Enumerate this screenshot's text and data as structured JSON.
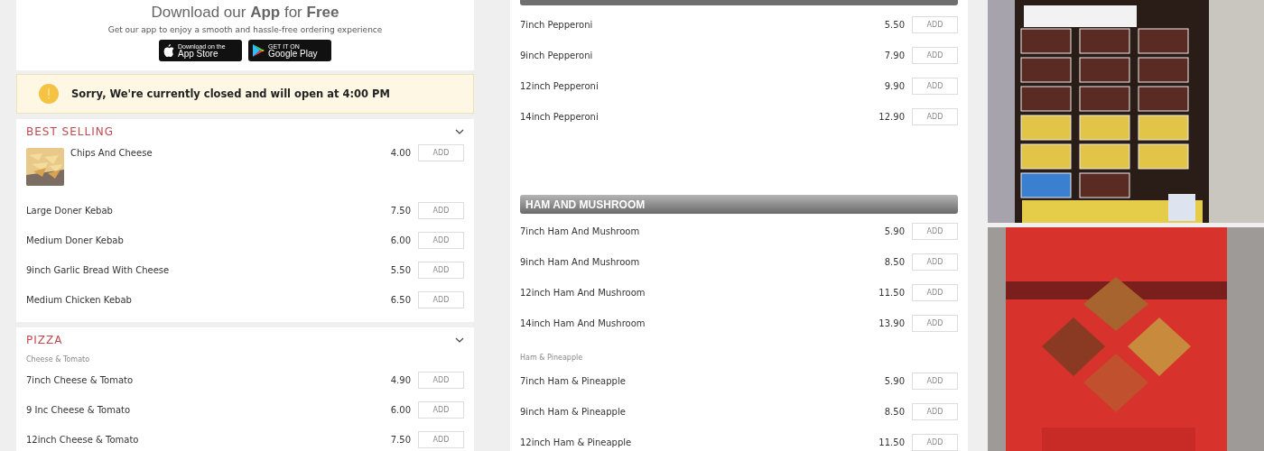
{
  "app_promo": {
    "title": "Download our **App** for **Free**",
    "subtitle": "Get our app to enjoy a smooth and hassle-free ordering experience",
    "store_badges": [
      {
        "kind": "apple",
        "small": "Download on the",
        "big": "App Store"
      },
      {
        "kind": "google",
        "small": "GET IT ON",
        "big": "Google Play"
      }
    ]
  },
  "notice": {
    "text": "Sorry, We're currently closed and will open at 4:00 PM"
  },
  "sections": [
    {
      "title": "BEST SELLING",
      "expanded": true,
      "groups": [
        {
          "items": [
            {
              "name": "Chips And Cheese",
              "price": "4.00",
              "image": true,
              "button": "ADD"
            },
            {
              "name": "Large Doner Kebab",
              "price": "7.50",
              "image": false,
              "button": "ADD"
            },
            {
              "name": "Medium Doner Kebab",
              "price": "6.00",
              "image": false,
              "button": "ADD"
            },
            {
              "name": "9inch Garlic Bread With Cheese",
              "price": "5.50",
              "image": false,
              "button": "ADD"
            },
            {
              "name": "Medium Chicken Kebab",
              "price": "6.50",
              "image": false,
              "button": "ADD"
            }
          ]
        }
      ]
    },
    {
      "title": "PIZZA",
      "expanded": true,
      "groups": [
        {
          "subtitle": "Cheese & Tomato",
          "items": [
            {
              "name": "7inch Cheese & Tomato",
              "price": "4.90",
              "image": false,
              "button": "ADD"
            },
            {
              "name": "9 Inc Cheese & Tomato",
              "price": "6.00",
              "image": false,
              "button": "ADD"
            },
            {
              "name": "12inch Cheese & Tomato",
              "price": "7.50",
              "image": false,
              "button": "ADD"
            }
          ]
        }
      ]
    }
  ],
  "menu_panel": {
    "categories": [
      {
        "groups": [
          {
            "items": [
              {
                "name": "7inch Pepperoni",
                "price": "5.50",
                "button": "ADD"
              },
              {
                "name": "9inch Pepperoni",
                "price": "7.90",
                "button": "ADD"
              },
              {
                "name": "12inch Pepperoni",
                "price": "9.90",
                "button": "ADD"
              },
              {
                "name": "14inch Pepperoni",
                "price": "12.90",
                "button": "ADD"
              }
            ]
          }
        ]
      },
      {
        "title": "HAM AND MUSHROOM",
        "groups": [
          {
            "items": [
              {
                "name": "7inch Ham And Mushroom",
                "price": "5.90",
                "button": "ADD"
              },
              {
                "name": "9inch Ham And Mushroom",
                "price": "8.50",
                "button": "ADD"
              },
              {
                "name": "12inch Ham And Mushroom",
                "price": "11.50",
                "button": "ADD"
              },
              {
                "name": "14inch Ham And Mushroom",
                "price": "13.90",
                "button": "ADD"
              }
            ]
          },
          {
            "subtitle": "Ham & Pineapple",
            "items": [
              {
                "name": "7inch Ham & Pineapple",
                "price": "5.90",
                "button": "ADD"
              },
              {
                "name": "9inch Ham & Pineapple",
                "price": "8.50",
                "button": "ADD"
              },
              {
                "name": "12inch Ham & Pineapple",
                "price": "11.50",
                "button": "ADD"
              }
            ]
          }
        ]
      }
    ]
  }
}
